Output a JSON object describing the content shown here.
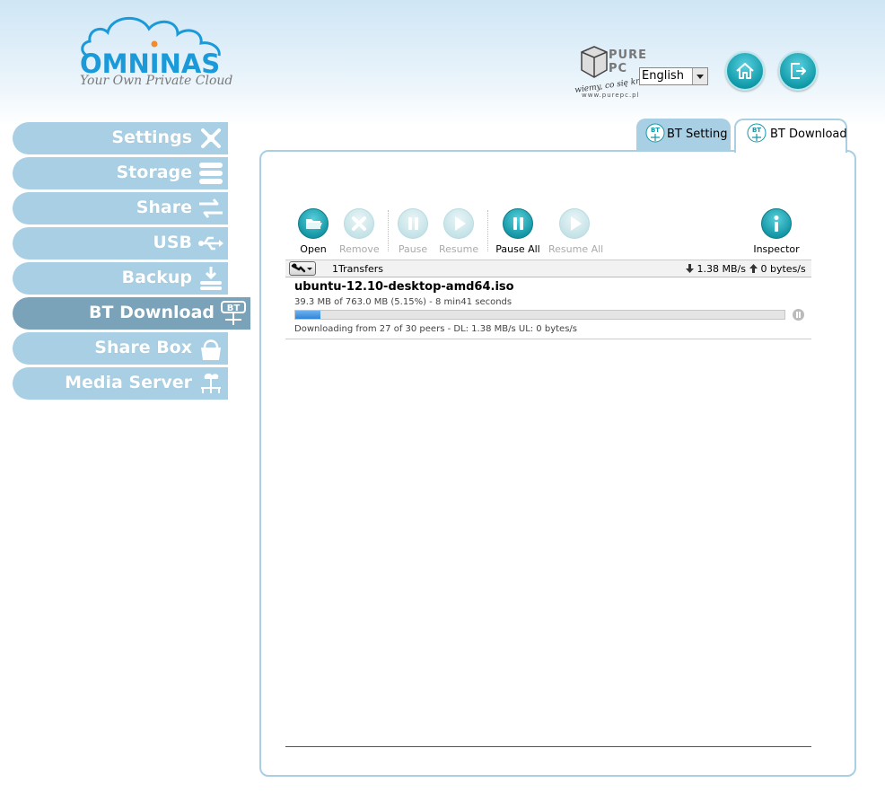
{
  "header": {
    "logo_word": "OMNINAS",
    "logo_tagline": "Your Own Private Cloud",
    "watermark_brand": "PURE PC",
    "watermark_slogan": "wiemy, co się kręci",
    "watermark_url": "www.purepc.pl",
    "language": "English"
  },
  "sidebar": {
    "items": [
      {
        "label": "Settings",
        "icon": "settings-icon"
      },
      {
        "label": "Storage",
        "icon": "storage-icon"
      },
      {
        "label": "Share",
        "icon": "share-icon"
      },
      {
        "label": "USB",
        "icon": "usb-icon"
      },
      {
        "label": "Backup",
        "icon": "backup-icon"
      },
      {
        "label": "BT Download",
        "icon": "bt-icon",
        "active": true
      },
      {
        "label": "Share Box",
        "icon": "sharebox-icon"
      },
      {
        "label": "Media Server",
        "icon": "media-server-icon"
      }
    ]
  },
  "tabs": {
    "bt_setting": "BT Setting",
    "bt_download": "BT Download",
    "icon_text": "BT"
  },
  "toolbar": {
    "open": "Open",
    "remove": "Remove",
    "pause": "Pause",
    "resume": "Resume",
    "pause_all": "Pause All",
    "resume_all": "Resume All",
    "inspector": "Inspector"
  },
  "statusbar": {
    "transfers": "1Transfers",
    "download_rate": "1.38 MB/s",
    "upload_rate": "0 bytes/s"
  },
  "torrent": {
    "name": "ubuntu-12.10-desktop-amd64.iso",
    "progress_text": "39.3 MB of 763.0 MB (5.15%) - 8 min41 seconds",
    "progress_fraction": 0.0515,
    "peers_text": "Downloading from 27 of 30 peers - DL: 1.38 MB/s UL: 0 bytes/s"
  },
  "colors": {
    "accent": "#1a9ad8",
    "nav": "#a8cfe3",
    "nav_active": "#7aa3b9",
    "teal": "#1698a6"
  }
}
